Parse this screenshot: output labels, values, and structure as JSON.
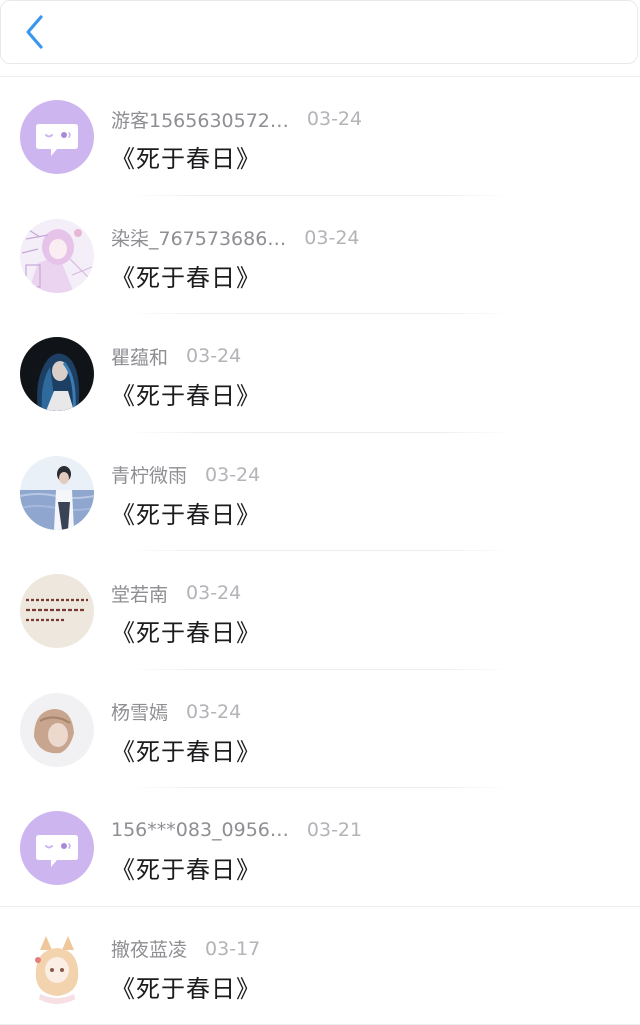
{
  "header": {
    "back_icon": "chevron-left-icon",
    "accent": "#3a97f0"
  },
  "comments": [
    {
      "user": "游客1565630572…",
      "date": "03-24",
      "text": "《死于春日》",
      "avatar": "chat-bubble-icon"
    },
    {
      "user": "染柒_767573686…",
      "date": "03-24",
      "text": "《死于春日》",
      "avatar": "anime-girl-photo"
    },
    {
      "user": "瞿蕴和",
      "date": "03-24",
      "text": "《死于春日》",
      "avatar": "blue-hair-girl-photo"
    },
    {
      "user": "青柠微雨",
      "date": "03-24",
      "text": "《死于春日》",
      "avatar": "sea-boy-photo"
    },
    {
      "user": "堂若南",
      "date": "03-24",
      "text": "《死于春日》",
      "avatar": "handwriting-photo"
    },
    {
      "user": "杨雪嫣",
      "date": "03-24",
      "text": "《死于春日》",
      "avatar": "blonde-girl-photo"
    },
    {
      "user": "156***083_0956…",
      "date": "03-21",
      "text": "《死于春日》",
      "avatar": "chat-bubble-icon"
    },
    {
      "user": "撤夜蓝凌",
      "date": "03-17",
      "text": "《死于春日》",
      "avatar": "anime-fox-girl-photo"
    }
  ],
  "colors": {
    "default_avatar_bg": "#c9b3ed",
    "username": "#8e8e93",
    "date": "#b3b3b8",
    "text": "#1c1c1e"
  }
}
